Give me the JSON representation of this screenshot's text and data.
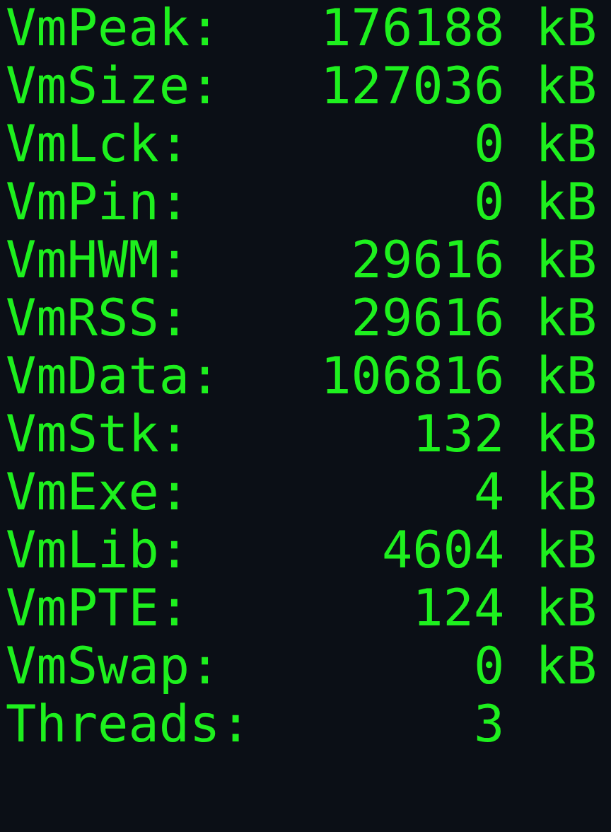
{
  "lines": [
    {
      "label": "VmPeak:",
      "value": "176188",
      "unit": "kB"
    },
    {
      "label": "VmSize:",
      "value": "127036",
      "unit": "kB"
    },
    {
      "label": "VmLck:",
      "value": "0",
      "unit": "kB"
    },
    {
      "label": "VmPin:",
      "value": "0",
      "unit": "kB"
    },
    {
      "label": "VmHWM:",
      "value": "29616",
      "unit": "kB"
    },
    {
      "label": "VmRSS:",
      "value": "29616",
      "unit": "kB"
    },
    {
      "label": "VmData:",
      "value": "106816",
      "unit": "kB"
    },
    {
      "label": "VmStk:",
      "value": "132",
      "unit": "kB"
    },
    {
      "label": "VmExe:",
      "value": "4",
      "unit": "kB"
    },
    {
      "label": "VmLib:",
      "value": "4604",
      "unit": "kB"
    },
    {
      "label": "VmPTE:",
      "value": "124",
      "unit": "kB"
    },
    {
      "label": "VmSwap:",
      "value": "0",
      "unit": "kB"
    },
    {
      "label": "Threads:",
      "value": "3"
    }
  ]
}
